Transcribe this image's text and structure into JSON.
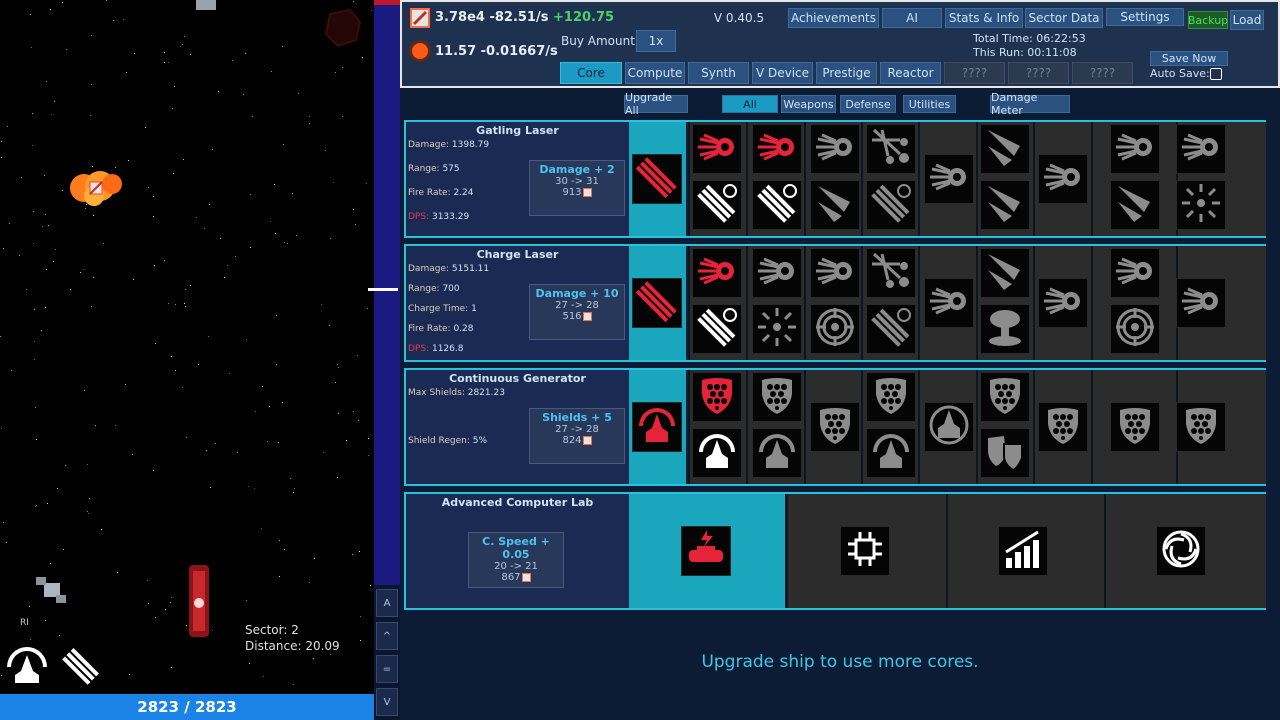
{
  "resources": {
    "scrap_line": "3.78e4 -82.51/s",
    "scrap_gain": "+120.75",
    "energy_line": "11.57 -0.01667/s"
  },
  "top": {
    "buy_amount_label": "Buy Amount:",
    "buy_amount_value": "1x",
    "version": "V 0.40.5",
    "nav": [
      "Achievements",
      "AI",
      "Stats & Info",
      "Sector Data",
      "Settings"
    ],
    "backup": "Backup",
    "load": "Load",
    "total_time": "Total Time: 06:22:53",
    "this_run": "This Run: 00:11:08",
    "save_now": "Save Now",
    "auto_save": "Auto Save:",
    "tabs": [
      "Core",
      "Compute",
      "Synth",
      "V Device",
      "Prestige",
      "Reactor",
      "????",
      "????",
      "????"
    ],
    "active_tab": "Core"
  },
  "filters": {
    "upgrade_all": "Upgrade All",
    "items": [
      "All",
      "Weapons",
      "Defense",
      "Utilities"
    ],
    "active": "All",
    "damage_meter": "Damage Meter"
  },
  "modules": [
    {
      "name": "Gatling Laser",
      "stats": [
        {
          "k": "Damage:",
          "v": "1398.79"
        },
        {
          "k": "Range:",
          "v": "575"
        },
        {
          "k": "Fire Rate:",
          "v": "2.24"
        },
        {
          "k": "DPS:",
          "v": "3133.29"
        }
      ],
      "upgrade": {
        "title": "Damage + 2",
        "range": "30 -> 31",
        "cost": "913"
      }
    },
    {
      "name": "Charge Laser",
      "stats": [
        {
          "k": "Damage:",
          "v": "5151.11"
        },
        {
          "k": "Range:",
          "v": "700"
        },
        {
          "k": "Charge Time:",
          "v": "1"
        },
        {
          "k": "Fire Rate:",
          "v": "0.28"
        },
        {
          "k": "DPS:",
          "v": "1126.8"
        }
      ],
      "upgrade": {
        "title": "Damage + 10",
        "range": "27 -> 28",
        "cost": "516"
      }
    },
    {
      "name": "Continuous Generator",
      "stats": [
        {
          "k": "Max Shields:",
          "v": "2821.23"
        },
        {
          "k": "Shield Regen:",
          "v": "5%"
        }
      ],
      "upgrade": {
        "title": "Shields + 5",
        "range": "27 -> 28",
        "cost": "824"
      }
    },
    {
      "name": "Advanced Computer Lab",
      "stats": [],
      "upgrade": {
        "title": "C. Speed + 0.05",
        "range": "20 -> 21",
        "cost": "867"
      }
    }
  ],
  "message": "Upgrade ship to use more cores.",
  "game": {
    "sector": "Sector: 2",
    "distance": "Distance: 20.09",
    "hp": "2823 / 2823",
    "ri": "RI"
  },
  "side_buttons": [
    "A",
    "^",
    "=",
    "V"
  ],
  "colors": {
    "accent": "#1aa7bd",
    "red": "#e23c4e",
    "panel": "#1b2a53"
  }
}
